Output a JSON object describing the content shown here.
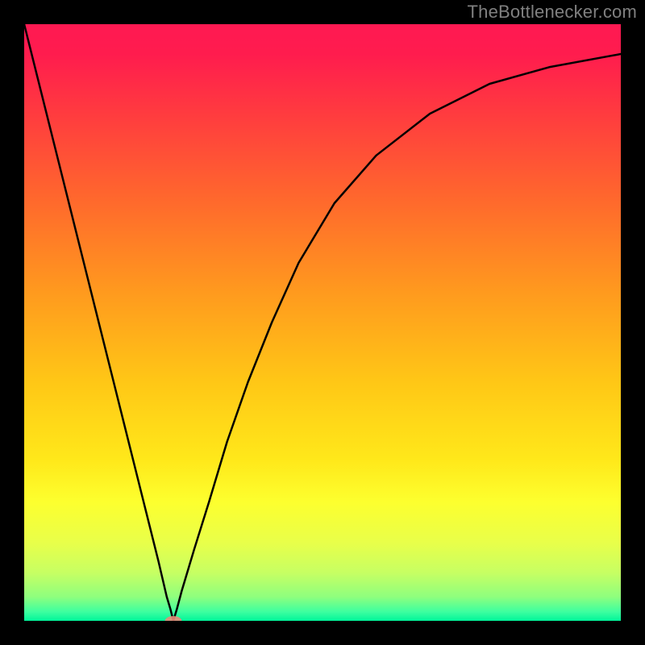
{
  "watermark": "TheBottlenecker.com",
  "chart_data": {
    "type": "line",
    "title": "",
    "xlabel": "",
    "ylabel": "",
    "xlim": [
      0,
      1
    ],
    "ylim": [
      0,
      1
    ],
    "grid": false,
    "legend": false,
    "background": {
      "gradient_stops": [
        {
          "offset": 0.0,
          "color": "#ff1952"
        },
        {
          "offset": 0.05,
          "color": "#ff1c4e"
        },
        {
          "offset": 0.15,
          "color": "#ff3b3f"
        },
        {
          "offset": 0.3,
          "color": "#ff6a2c"
        },
        {
          "offset": 0.45,
          "color": "#ff9a1e"
        },
        {
          "offset": 0.6,
          "color": "#ffc716"
        },
        {
          "offset": 0.73,
          "color": "#ffe81a"
        },
        {
          "offset": 0.8,
          "color": "#fdff2e"
        },
        {
          "offset": 0.87,
          "color": "#e8ff4a"
        },
        {
          "offset": 0.92,
          "color": "#c6ff63"
        },
        {
          "offset": 0.96,
          "color": "#8eff7e"
        },
        {
          "offset": 0.985,
          "color": "#3dffa0"
        },
        {
          "offset": 1.0,
          "color": "#00f59a"
        }
      ]
    },
    "series": [
      {
        "name": "curve",
        "color": "#000000",
        "stroke_width": 2.5,
        "points": [
          {
            "x": 0.0,
            "y": 1.0
          },
          {
            "x": 0.05,
            "y": 0.8
          },
          {
            "x": 0.1,
            "y": 0.6
          },
          {
            "x": 0.15,
            "y": 0.4
          },
          {
            "x": 0.2,
            "y": 0.2
          },
          {
            "x": 0.225,
            "y": 0.1
          },
          {
            "x": 0.239,
            "y": 0.04
          },
          {
            "x": 0.245,
            "y": 0.02
          },
          {
            "x": 0.25,
            "y": 0.0
          },
          {
            "x": 0.256,
            "y": 0.02
          },
          {
            "x": 0.264,
            "y": 0.05
          },
          {
            "x": 0.285,
            "y": 0.12
          },
          {
            "x": 0.31,
            "y": 0.2
          },
          {
            "x": 0.34,
            "y": 0.3
          },
          {
            "x": 0.375,
            "y": 0.4
          },
          {
            "x": 0.415,
            "y": 0.5
          },
          {
            "x": 0.46,
            "y": 0.6
          },
          {
            "x": 0.52,
            "y": 0.7
          },
          {
            "x": 0.59,
            "y": 0.78
          },
          {
            "x": 0.68,
            "y": 0.85
          },
          {
            "x": 0.78,
            "y": 0.9
          },
          {
            "x": 0.88,
            "y": 0.928
          },
          {
            "x": 1.0,
            "y": 0.95
          }
        ]
      }
    ],
    "marker": {
      "name": "minimum-marker",
      "color": "#e88a7a",
      "opacity": 0.9,
      "x": 0.25,
      "y": 0.0,
      "rx": 0.014,
      "ry": 0.008
    }
  }
}
